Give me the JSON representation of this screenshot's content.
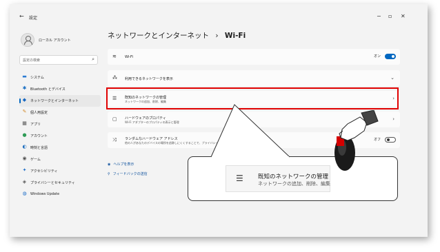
{
  "window": {
    "back": "←",
    "title": "設定",
    "minimize": "−",
    "maximize": "▫",
    "close": "✕"
  },
  "sidebar": {
    "profile_name": "ローカル アカウント",
    "search_placeholder": "設定の検索",
    "search_icon": "⌕",
    "items": [
      {
        "label": "システム",
        "icon": "▬",
        "color": "#2b7cd3"
      },
      {
        "label": "Bluetooth とデバイス",
        "icon": "✱",
        "color": "#1e72c4"
      },
      {
        "label": "ネットワークとインターネット",
        "icon": "◆",
        "color": "#1565c0",
        "active": true
      },
      {
        "label": "個人用設定",
        "icon": "✎",
        "color": "#d28a2b"
      },
      {
        "label": "アプリ",
        "icon": "▦",
        "color": "#555555"
      },
      {
        "label": "アカウント",
        "icon": "●",
        "color": "#2e9b56"
      },
      {
        "label": "時刻と言語",
        "icon": "◐",
        "color": "#1f6fbf"
      },
      {
        "label": "ゲーム",
        "icon": "◉",
        "color": "#555555"
      },
      {
        "label": "アクセシビリティ",
        "icon": "✦",
        "color": "#1e6ec8"
      },
      {
        "label": "プライバシーとセキュリティ",
        "icon": "◈",
        "color": "#555555"
      },
      {
        "label": "Windows Update",
        "icon": "◍",
        "color": "#1e6ec8"
      }
    ]
  },
  "main": {
    "breadcrumb_parent": "ネットワークとインターネット",
    "breadcrumb_sep": "›",
    "breadcrumb_current": "Wi-Fi",
    "wifi": {
      "icon": "≋",
      "label": "Wi-Fi",
      "state": "オン"
    },
    "available": {
      "icon": "⁂",
      "label": "利用できるネットワークを表示",
      "chevron": "⌄"
    },
    "known": {
      "icon": "☰",
      "label": "既知のネットワークの管理",
      "sub": "ネットワークの追加、削除、編集",
      "chevron": "›"
    },
    "hardware": {
      "icon": "▢",
      "label": "ハードウェアのプロパティ",
      "sub": "Wi-Fi アダプターのプロパティの表示と管理",
      "chevron": "›"
    },
    "random": {
      "icon": "⤨",
      "label": "ランダムなハードウェア アドレス",
      "sub": "他の人があなたのデバイスの場所を追跡しにくくすることで、プライバシーの保",
      "state": "オフ"
    },
    "help_link": "ヘルプを表示",
    "help_icon": "◉",
    "feedback_link": "フィードバックの送信",
    "feedback_icon": "⚲"
  },
  "callout": {
    "icon": "☰",
    "title": "既知のネットワークの管理",
    "sub": "ネットワークの追加、削除、編集"
  }
}
